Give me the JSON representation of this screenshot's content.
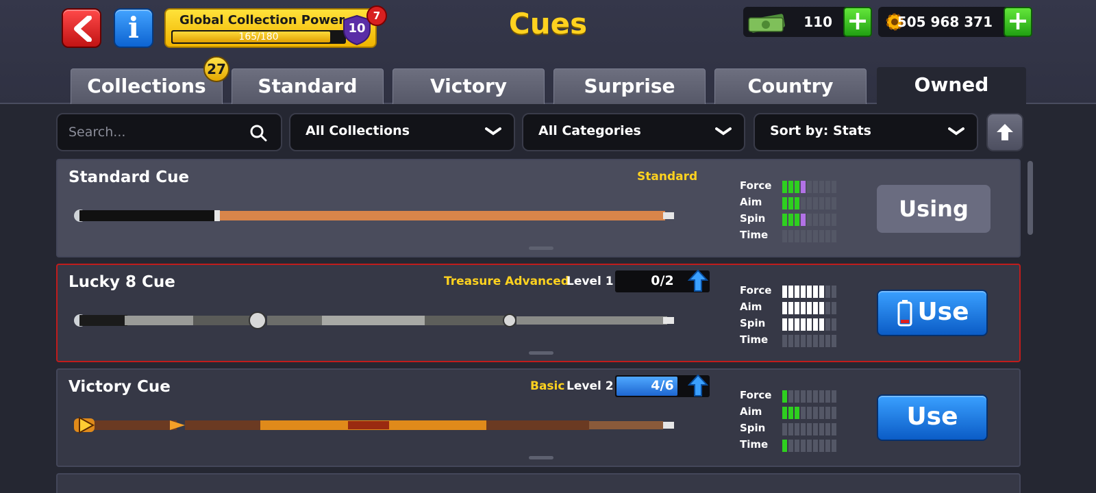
{
  "header": {
    "title": "Cues",
    "collection_power": {
      "label": "Global Collection Power",
      "value": "165/180",
      "progress": 0.917,
      "level": "10",
      "notification_count": "7"
    },
    "cash": {
      "value": "110"
    },
    "coins": {
      "value": "505 968 371"
    }
  },
  "tabs": [
    {
      "label": "Collections",
      "badge": "27"
    },
    {
      "label": "Standard"
    },
    {
      "label": "Victory"
    },
    {
      "label": "Surprise"
    },
    {
      "label": "Country"
    },
    {
      "label": "Owned",
      "active": true
    }
  ],
  "filters": {
    "search_placeholder": "Search...",
    "collections": "All Collections",
    "categories": "All Categories",
    "sort": "Sort by: Stats"
  },
  "stat_labels": [
    "Force",
    "Aim",
    "Spin",
    "Time"
  ],
  "cues": [
    {
      "name": "Standard Cue",
      "category": "Standard",
      "level": "",
      "pieces": "",
      "stats": {
        "force": {
          "green": 3,
          "purple": 1
        },
        "aim": {
          "green": 3,
          "purple": 0
        },
        "spin": {
          "green": 3,
          "purple": 1
        },
        "time": {
          "green": 0,
          "purple": 0
        }
      },
      "button": "Using"
    },
    {
      "name": "Lucky 8 Cue",
      "category": "Treasure Advanced",
      "level": "Level 1",
      "pieces": "0/2",
      "pieces_progress": 0,
      "stats": {
        "force": 7,
        "aim": 7,
        "spin": 7,
        "time": 0
      },
      "button": "Use"
    },
    {
      "name": "Victory Cue",
      "category": "Basic",
      "level": "Level 2",
      "pieces": "4/6",
      "pieces_progress": 0.667,
      "stats": {
        "force": 1,
        "aim": 3,
        "spin": 0,
        "time": 1
      },
      "button": "Use"
    }
  ],
  "colors": {
    "accent_gold": "#ffd21f",
    "use_blue": "#1e66d0",
    "stat_green": "#2ed01f",
    "stat_purple": "#b272e6",
    "selected_border": "#c11c1c"
  },
  "icons": {
    "back": "back-arrow-icon",
    "info": "info-icon",
    "cash": "cash-icon",
    "coins": "coin-gear-icon",
    "search": "search-icon",
    "chevron": "chevron-down-icon",
    "sort": "arrow-up-icon",
    "upgrade": "upgrade-arrow-icon",
    "battery": "battery-icon"
  }
}
